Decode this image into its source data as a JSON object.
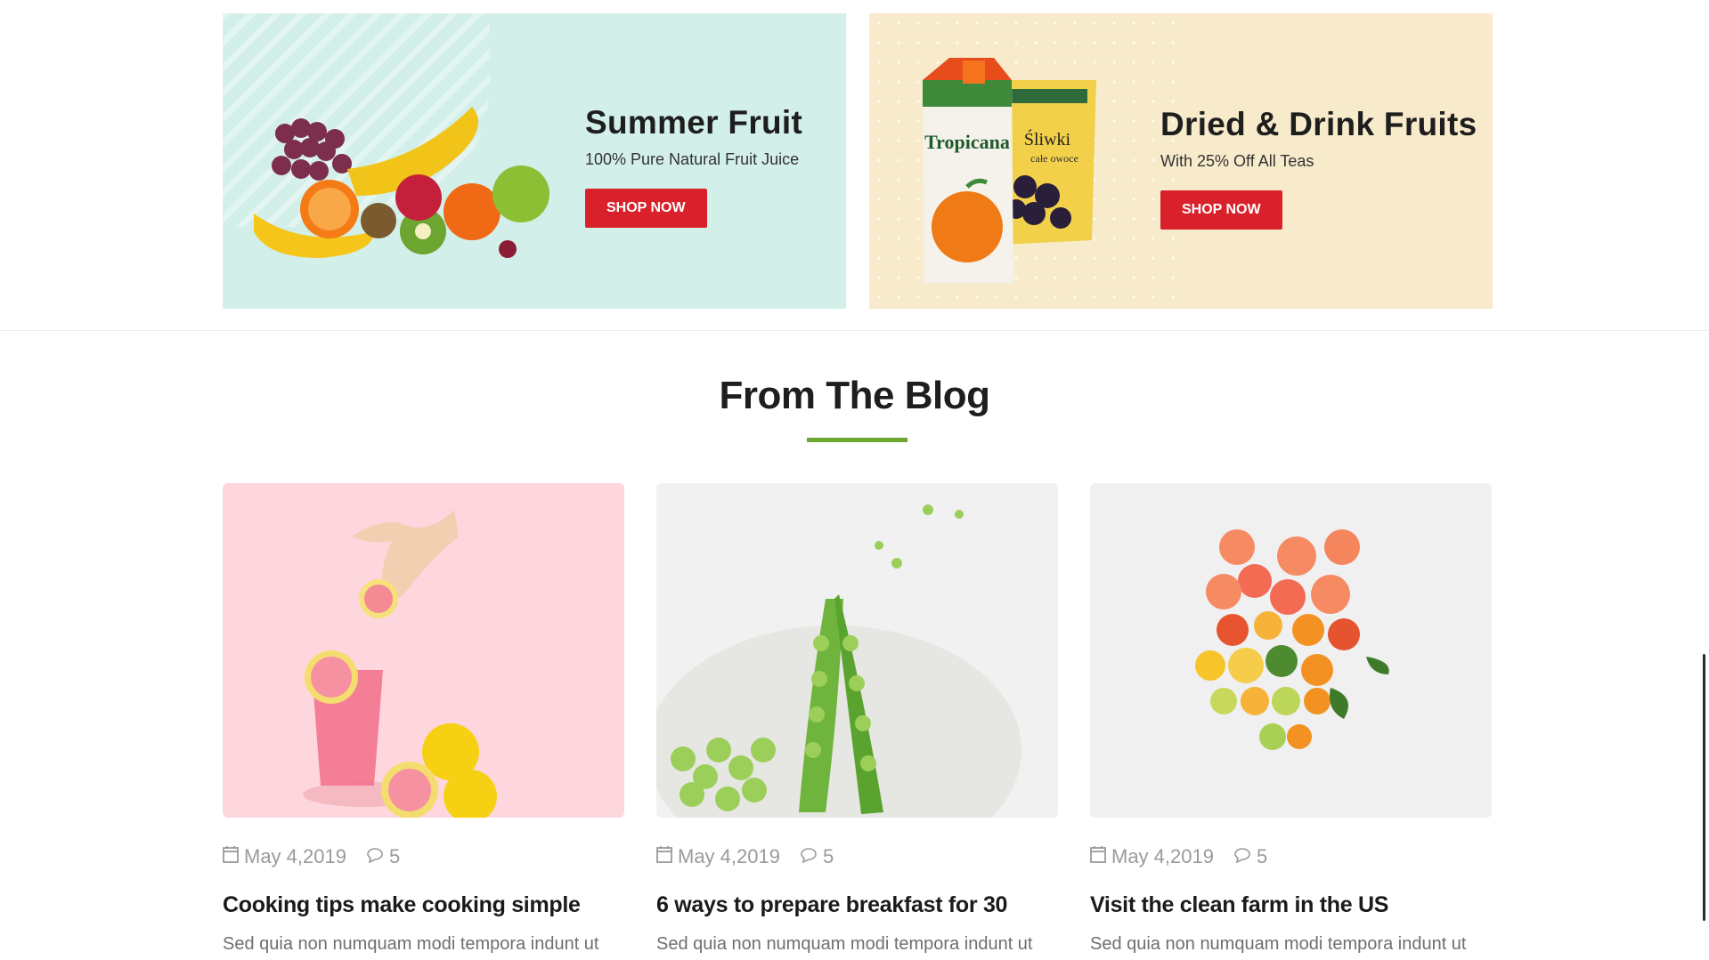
{
  "banners": [
    {
      "title": "Summer Fruit",
      "subtitle": "100% Pure Natural Fruit Juice",
      "button": "SHOP NOW"
    },
    {
      "title": "Dried & Drink Fruits",
      "subtitle": "With 25% Off All Teas",
      "button": "SHOP NOW"
    }
  ],
  "product_labels": {
    "brand": "Tropicana",
    "dried_brand": "Śliwki",
    "dried_sub": "całe owoce"
  },
  "blog": {
    "title": "From The Blog",
    "posts": [
      {
        "date": "May 4,2019",
        "comments": "5",
        "title": "Cooking tips make cooking simple",
        "excerpt": "Sed quia non numquam modi tempora indunt ut"
      },
      {
        "date": "May 4,2019",
        "comments": "5",
        "title": "6 ways to prepare breakfast for 30",
        "excerpt": "Sed quia non numquam modi tempora indunt ut"
      },
      {
        "date": "May 4,2019",
        "comments": "5",
        "title": "Visit the clean farm in the US",
        "excerpt": "Sed quia non numquam modi tempora indunt ut"
      }
    ]
  },
  "colors": {
    "accent_red": "#d9212b",
    "accent_green": "#6ea632",
    "banner_mint": "#d3efe9",
    "banner_cream": "#f8ebcb"
  },
  "icons": {
    "date": "calendar-icon",
    "comments": "comment-icon"
  }
}
